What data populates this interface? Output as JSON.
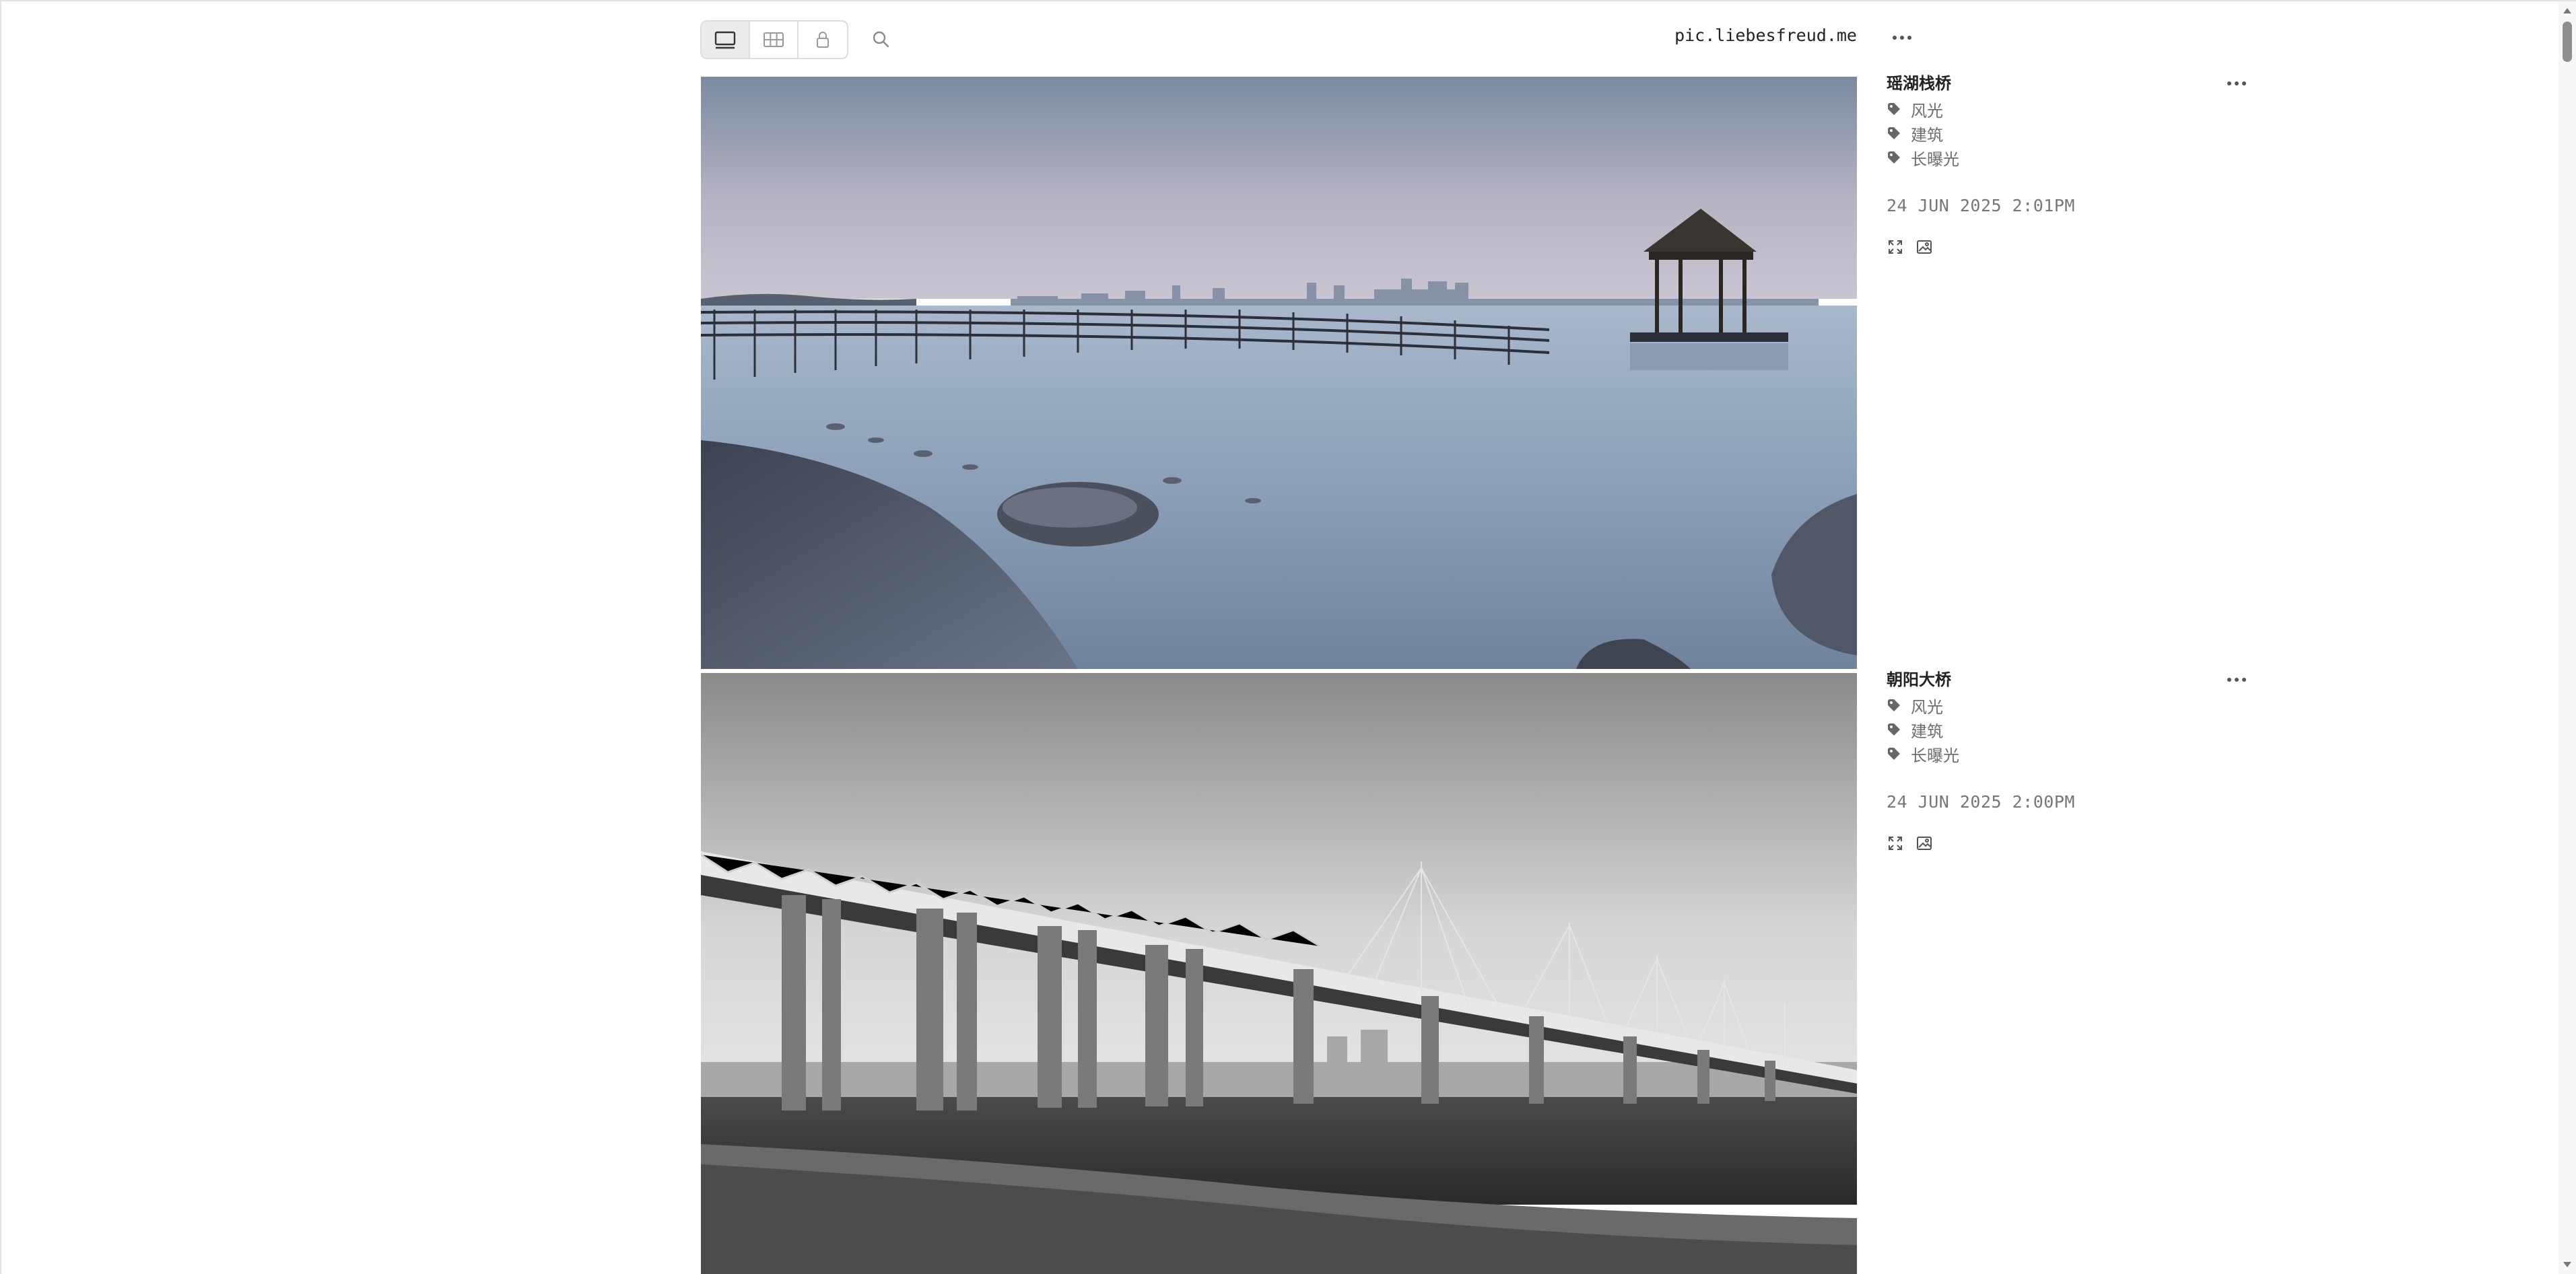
{
  "nav": {
    "site_title": "pic.liebesfreud.me",
    "views": [
      {
        "icon": "single-view-icon",
        "active": true
      },
      {
        "icon": "grid-view-icon",
        "active": false
      },
      {
        "icon": "lock-icon",
        "active": false
      }
    ],
    "search_icon": "search-icon",
    "more_icon": "ellipsis-icon"
  },
  "photos": [
    {
      "title": "瑶湖栈桥",
      "tags": [
        "风光",
        "建筑",
        "长曝光"
      ],
      "date": "24 JUN 2025 2:01PM",
      "actions": [
        "fullscreen-icon",
        "image-download-icon"
      ]
    },
    {
      "title": "朝阳大桥",
      "tags": [
        "风光",
        "建筑",
        "长曝光"
      ],
      "date": "24 JUN 2025 2:00PM",
      "actions": [
        "fullscreen-icon",
        "image-download-icon"
      ]
    }
  ],
  "colors": {
    "accent": "#222222",
    "tag_text": "#6e6e6e",
    "date_text": "#777777",
    "border": "#dcdcdc"
  }
}
